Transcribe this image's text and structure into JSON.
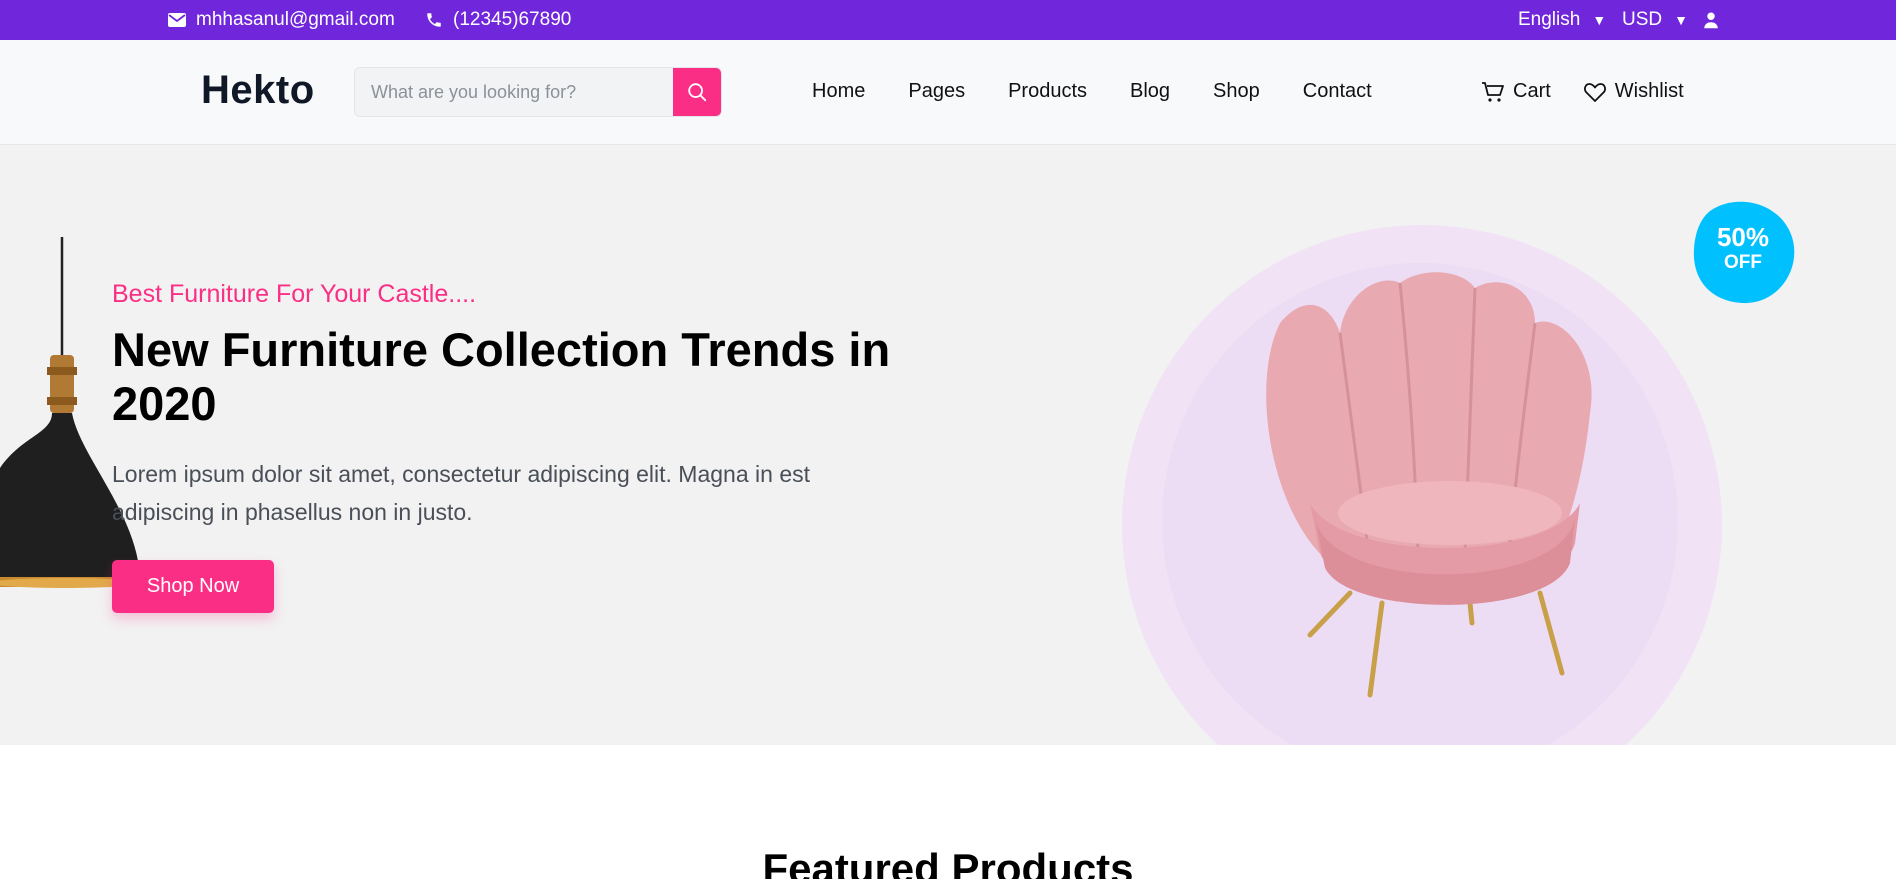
{
  "topbar": {
    "email": "mhhasanul@gmail.com",
    "phone": "(12345)67890",
    "language": "English",
    "currency": "USD",
    "icons": [
      "mail-icon",
      "phone-icon",
      "user-icon"
    ],
    "background": "#7027DC"
  },
  "header": {
    "logo": "Hekto",
    "search": {
      "placeholder": "What are you looking for?",
      "value": ""
    },
    "nav": [
      "Home",
      "Pages",
      "Products",
      "Blog",
      "Shop",
      "Contact"
    ],
    "cart_label": "Cart",
    "wishlist_label": "Wishlist"
  },
  "hero": {
    "subheading": "Best Furniture For Your Castle....",
    "headline": "New Furniture Collection Trends in 2020",
    "description": "Lorem ipsum dolor sit amet, consectetur adipiscing elit. Magna in est adipiscing in phasellus non in justo.",
    "button_label": "Shop Now",
    "badge": {
      "percent": "50%",
      "off": "OFF"
    }
  },
  "featured": {
    "title": "Featured Products"
  },
  "colors": {
    "accent": "#FB2E86",
    "badge": "#00C1FE",
    "purple": "#7027DC"
  }
}
